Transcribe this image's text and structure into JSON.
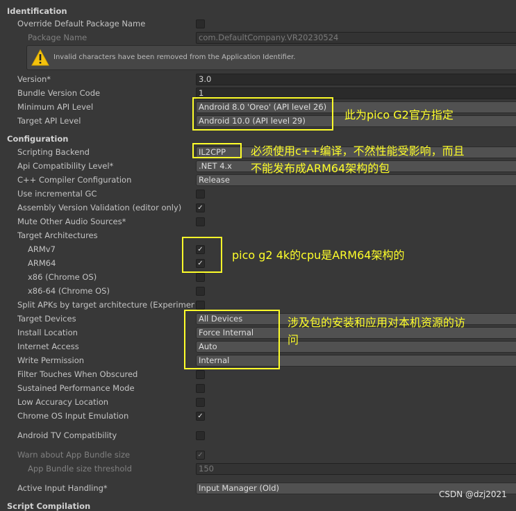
{
  "sections": {
    "identification": "Identification",
    "configuration": "Configuration",
    "script_compilation": "Script Compilation"
  },
  "identification": {
    "override_label": "Override Default Package Name",
    "override_checked": false,
    "package_name_label": "Package Name",
    "package_name_value": "com.DefaultCompany.VR20230524",
    "warning_text": "Invalid characters have been removed from the Application Identifier.",
    "warning_icon": "warning-triangle-icon",
    "version_label": "Version*",
    "version_value": "3.0",
    "bundle_code_label": "Bundle Version Code",
    "bundle_code_value": "1",
    "min_api_label": "Minimum API Level",
    "min_api_value": "Android 8.0 'Oreo' (API level 26)",
    "target_api_label": "Target API Level",
    "target_api_value": "Android 10.0 (API level 29)"
  },
  "configuration": {
    "scripting_backend_label": "Scripting Backend",
    "scripting_backend_value": "IL2CPP",
    "api_compat_label": "Api Compatibility Level*",
    "api_compat_value": ".NET 4.x",
    "cpp_config_label": "C++ Compiler Configuration",
    "cpp_config_value": "Release",
    "incremental_gc_label": "Use incremental GC",
    "incremental_gc_checked": false,
    "assembly_validation_label": "Assembly Version Validation (editor only)",
    "assembly_validation_checked": true,
    "mute_audio_label": "Mute Other Audio Sources*",
    "mute_audio_checked": false,
    "target_arch_label": "Target Architectures",
    "armv7_label": "ARMv7",
    "armv7_checked": true,
    "arm64_label": "ARM64",
    "arm64_checked": true,
    "x86_label": "x86 (Chrome OS)",
    "x86_checked": false,
    "x86_64_label": "x86-64 (Chrome OS)",
    "x86_64_checked": false,
    "split_apks_label": "Split APKs by target architecture (Experimental)",
    "split_apks_checked": false,
    "target_devices_label": "Target Devices",
    "target_devices_value": "All Devices",
    "install_location_label": "Install Location",
    "install_location_value": "Force Internal",
    "internet_access_label": "Internet Access",
    "internet_access_value": "Auto",
    "write_permission_label": "Write Permission",
    "write_permission_value": "Internal",
    "filter_touches_label": "Filter Touches When Obscured",
    "filter_touches_checked": false,
    "sustained_perf_label": "Sustained Performance Mode",
    "sustained_perf_checked": false,
    "low_accuracy_label": "Low Accuracy Location",
    "low_accuracy_checked": false,
    "chrome_input_label": "Chrome OS Input Emulation",
    "chrome_input_checked": true,
    "android_tv_label": "Android TV Compatibility",
    "android_tv_checked": false,
    "warn_bundle_label": "Warn about App Bundle size",
    "warn_bundle_checked": true,
    "bundle_threshold_label": "App Bundle size threshold",
    "bundle_threshold_value": "150",
    "input_handling_label": "Active Input Handling*",
    "input_handling_value": "Input Manager (Old)"
  },
  "annotations": {
    "api_note": "此为pico G2官方指定",
    "backend_note_line1": "必须使用c++编译，不然性能受影响，而且",
    "backend_note_line2": "不能发布成ARM64架构的包",
    "arch_note": "pico g2 4k的cpu是ARM64架构的",
    "devices_note_line1": "涉及包的安装和应用对本机资源的访",
    "devices_note_line2": "问",
    "color": "#ffff2a"
  },
  "watermark": "CSDN @dzj2021",
  "check_glyph": "✓",
  "colors": {
    "background": "#383838",
    "field": "#2a2a2a",
    "dropdown": "#515151",
    "annotation": "#ffff2a"
  }
}
